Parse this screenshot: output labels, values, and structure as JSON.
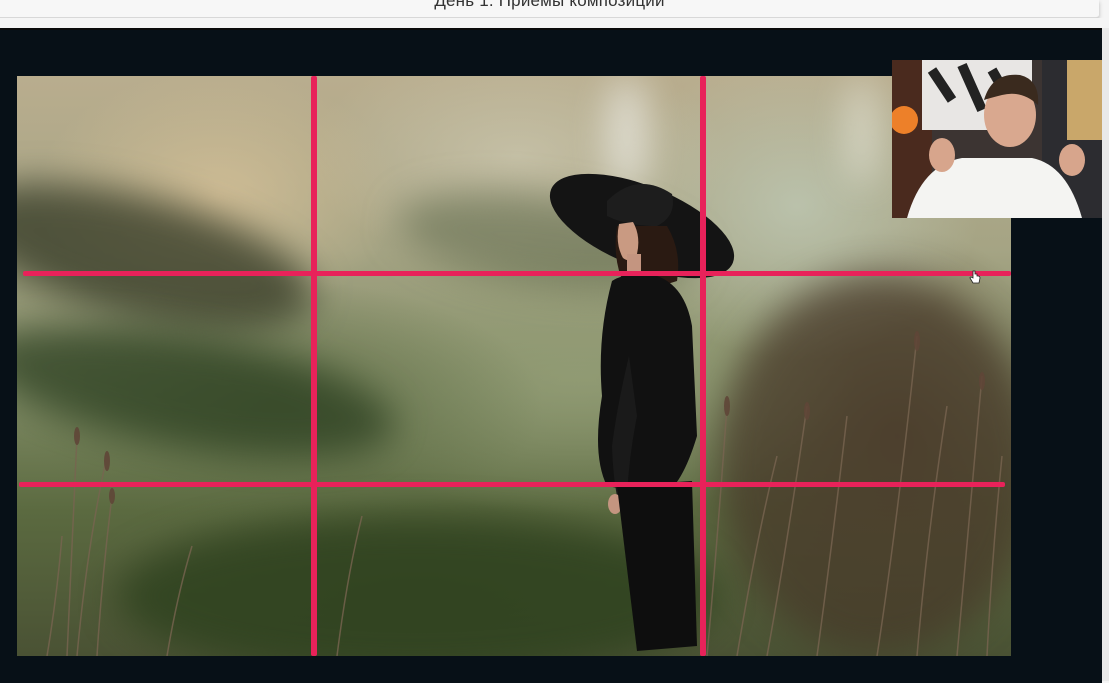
{
  "header": {
    "title": "День 1. Приемы композиции"
  },
  "lesson": {
    "grid_color": "#e8225a",
    "background_color": "#071017"
  },
  "icons": {
    "cursor": "hand-cursor-icon"
  }
}
